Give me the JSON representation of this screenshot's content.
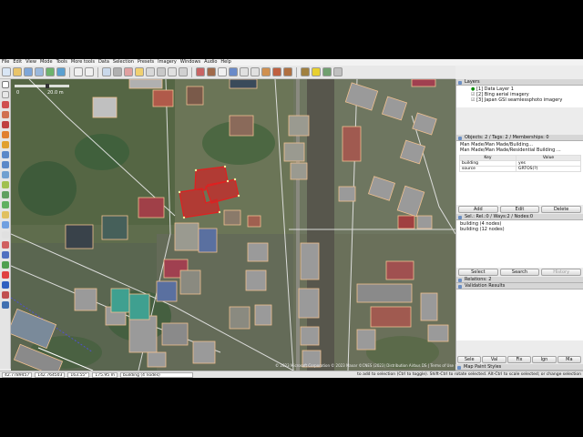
{
  "menu": [
    "File",
    "Edit",
    "View",
    "Mode",
    "Tools",
    "More tools",
    "Data",
    "Selection",
    "Presets",
    "Imagery",
    "Windows",
    "Audio",
    "Help"
  ],
  "map": {
    "scale_label": "20.0 m",
    "zoom_label": "0",
    "attribution": "© 2023 Microsoft Corporation © 2023 Maxar ©CNES (2023) Distribution Airbus DS | Terms of Use"
  },
  "layers": {
    "title": "Layers",
    "items": [
      {
        "index": "[1]",
        "name": "Data Layer 1"
      },
      {
        "index": "[2]",
        "name": "Bing aerial imagery"
      },
      {
        "index": "[3]",
        "name": "Japan GSI seamlessphoto imagery"
      }
    ]
  },
  "tags": {
    "title": "Objects: 2 / Tags: 2 / Memberships: 0",
    "presets": [
      "Man Made/Man Made/Building...",
      "Man Made/Man Made/Residential Building ..."
    ],
    "headers": [
      "Key",
      "Value"
    ],
    "rows": [
      {
        "key": "building",
        "value": "yes"
      },
      {
        "key": "source",
        "value": "GRTOS(?)"
      }
    ],
    "buttons": [
      "Add",
      "Edit",
      "Delete"
    ]
  },
  "selection": {
    "title": "Sel.: Rel.:0 / Ways:2 / Nodes:0",
    "items": [
      "building (4 nodes)",
      "building (12 nodes)"
    ],
    "buttons": [
      "Select",
      "Search",
      "History"
    ]
  },
  "relations": {
    "title": "Relations: 2",
    "validation_title": "Validation Results"
  },
  "bottom_tabs": [
    "Sele",
    "Val",
    "Fix",
    "Ign",
    "Ma"
  ],
  "map_paint": {
    "title": "Map Paint Styles"
  },
  "status": {
    "lat": "42.7789457",
    "lon": "142.764503",
    "heading": "163.55°",
    "angle": "",
    "distance": "175.95 m",
    "info": "building (4 nodes)",
    "hint": "to add to selection (Ctrl to toggle). Shift-Ctrl to rotate selected. Alt-Ctrl to scale selected; or change selection"
  },
  "colors": {
    "selection": "#e02020",
    "building_outline": "#f0c090",
    "road": "#e8e8e8",
    "panel_bg": "#ececec"
  }
}
